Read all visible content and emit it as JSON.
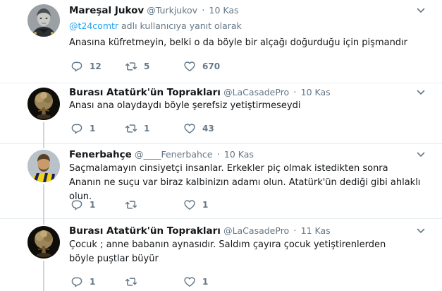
{
  "tweets": [
    {
      "name": "Mareşal Jukov",
      "handle": "@Turkjukov",
      "sep": "·",
      "time": "10 Kas",
      "reply_mention": "@t24comtr",
      "reply_text": " adlı kullanıcıya yanıt olarak",
      "text": "Anasına küfretmeyin, belki o da böyle bir alçağı doğurduğu için pişmandır",
      "replies": "12",
      "retweets": "5",
      "likes": "670"
    },
    {
      "name": "Burası Atatürk'ün Toprakları",
      "handle": "@LaCasadePro",
      "sep": "·",
      "time": "10 Kas",
      "text": "Anası ana olaydaydı böyle şerefsiz yetiştirmeseydi",
      "replies": "1",
      "retweets": "1",
      "likes": "43"
    },
    {
      "name": "Fenerbahçe",
      "handle": "@____Fenerbahce",
      "sep": "·",
      "time": "10 Kas",
      "text": "Saçmalamayın cinsiyetçi insanlar. Erkekler piç olmak istedikten sonra Ananın ne suçu var biraz kalbinizın adamı olun. Atatürk'ün dediği gibi ahlaklı olun.",
      "replies": "1",
      "retweets": "",
      "likes": "1"
    },
    {
      "name": "Burası Atatürk'ün Toprakları",
      "handle": "@LaCasadePro",
      "sep": "·",
      "time": "11 Kas",
      "text": "Çocuk ; anne babanın aynasıdır. Saldım çayıra çocuk yetiştirenlerden böyle puştlar büyür",
      "replies": "1",
      "retweets": "",
      "likes": "1"
    }
  ],
  "colors": {
    "accent": "#1da1f2",
    "muted": "#657786",
    "text": "#14171a",
    "divider": "#e6ecf0",
    "thread": "#ccd6dd"
  },
  "icons": [
    "reply-icon",
    "retweet-icon",
    "like-icon",
    "chevron-down-icon"
  ]
}
